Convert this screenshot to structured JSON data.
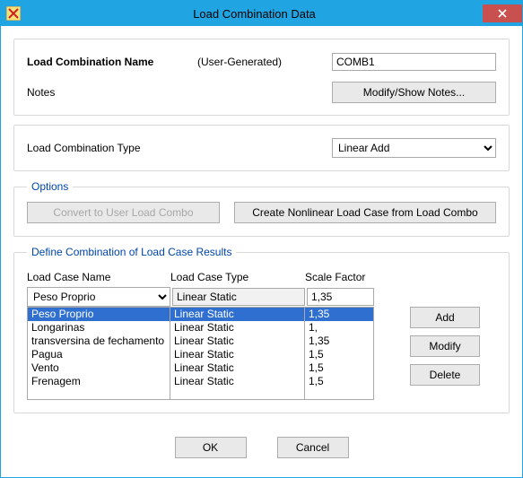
{
  "window": {
    "title": "Load Combination Data"
  },
  "section_name": {
    "name_label": "Load Combination Name",
    "origin_label": "(User-Generated)",
    "name_value": "COMB1",
    "notes_label": "Notes",
    "notes_button": "Modify/Show Notes..."
  },
  "section_type": {
    "type_label": "Load Combination Type",
    "type_value": "Linear Add"
  },
  "options": {
    "legend": "Options",
    "convert_button": "Convert to User Load Combo",
    "create_button": "Create Nonlinear Load Case from Load Combo"
  },
  "defs": {
    "legend": "Define Combination of Load Case Results",
    "headers": {
      "name": "Load Case Name",
      "type": "Load Case Type",
      "sf": "Scale Factor"
    },
    "input": {
      "name": "Peso Proprio",
      "type": "Linear Static",
      "sf": "1,35"
    },
    "rows": [
      {
        "name": "Peso Proprio",
        "type": "Linear Static",
        "sf": "1,35"
      },
      {
        "name": "Longarinas",
        "type": "Linear Static",
        "sf": "1,"
      },
      {
        "name": "transversina de fechamento",
        "type": "Linear Static",
        "sf": "1,35"
      },
      {
        "name": "Pagua",
        "type": "Linear Static",
        "sf": "1,5"
      },
      {
        "name": "Vento",
        "type": "Linear Static",
        "sf": "1,5"
      },
      {
        "name": "Frenagem",
        "type": "Linear Static",
        "sf": "1,5"
      }
    ],
    "selected_index": 0,
    "side_buttons": {
      "add": "Add",
      "modify": "Modify",
      "delete": "Delete"
    }
  },
  "dialog_buttons": {
    "ok": "OK",
    "cancel": "Cancel"
  }
}
